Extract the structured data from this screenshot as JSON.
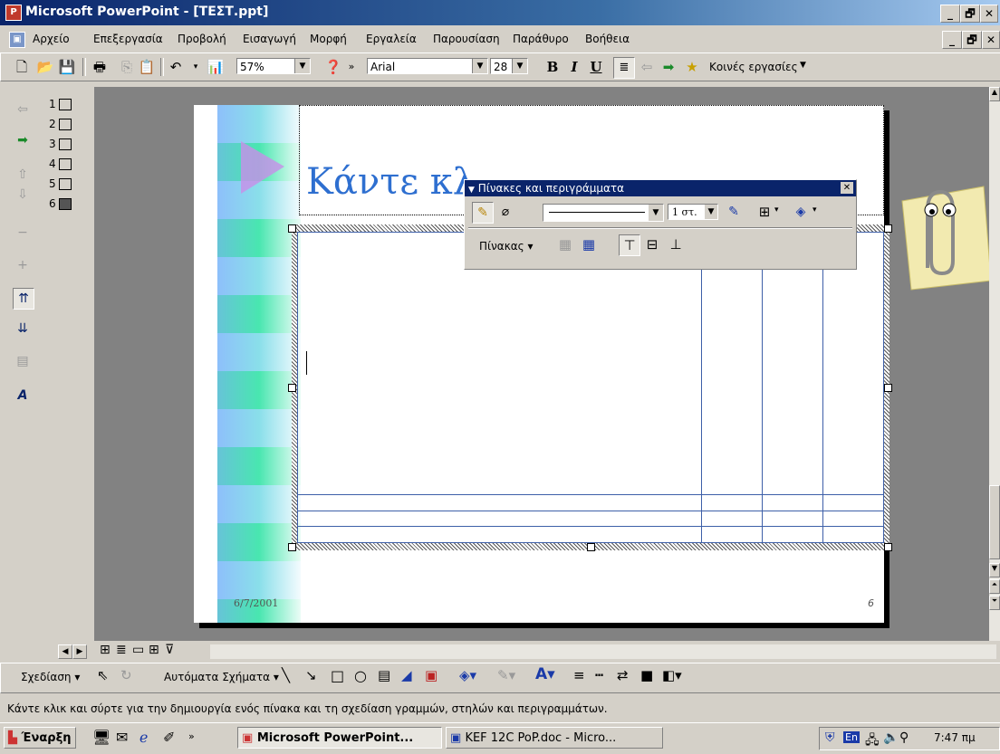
{
  "window": {
    "title": "Microsoft PowerPoint - [ΤΕΣΤ.ppt]",
    "min": "_",
    "max": "🗗",
    "close": "✕"
  },
  "menu": [
    "Αρχείο",
    "Επεξεργασία",
    "Προβολή",
    "Εισαγωγή",
    "Μορφή",
    "Εργαλεία",
    "Παρουσίαση",
    "Παράθυρο",
    "Βοήθεια"
  ],
  "toolbar": {
    "zoom": "57%",
    "font": "Arial",
    "size": "28",
    "bold": "B",
    "italic": "I",
    "underline": "U",
    "tasks": "Κοινές εργασίες"
  },
  "outline_numbers": [
    "1",
    "2",
    "3",
    "4",
    "5",
    "6"
  ],
  "slide": {
    "title": "Κάντε κλ",
    "date": "6/7/2001",
    "page": "6"
  },
  "table_panel": {
    "title": "Πίνακες και περιγράμματα",
    "weight": "1 στ.",
    "table_menu": "Πίνακας"
  },
  "drawbar": {
    "draw": "Σχεδίαση",
    "autoshapes": "Αυτόματα Σχήματα"
  },
  "status": "Κάντε κλικ και σύρτε για την δημιουργία ενός πίνακα και τη σχεδίαση γραμμών, στηλών και περιγραμμάτων.",
  "taskbar": {
    "start": "Έναρξη",
    "task1": "Microsoft PowerPoint...",
    "task2": "KEF 12C  PoP.doc - Micro...",
    "lang": "En",
    "clock": "7:47 πμ"
  },
  "colors": {
    "title_blue": "#0a246a",
    "slide_title": "#2e6fd0",
    "table_line": "#3d5fa8"
  }
}
